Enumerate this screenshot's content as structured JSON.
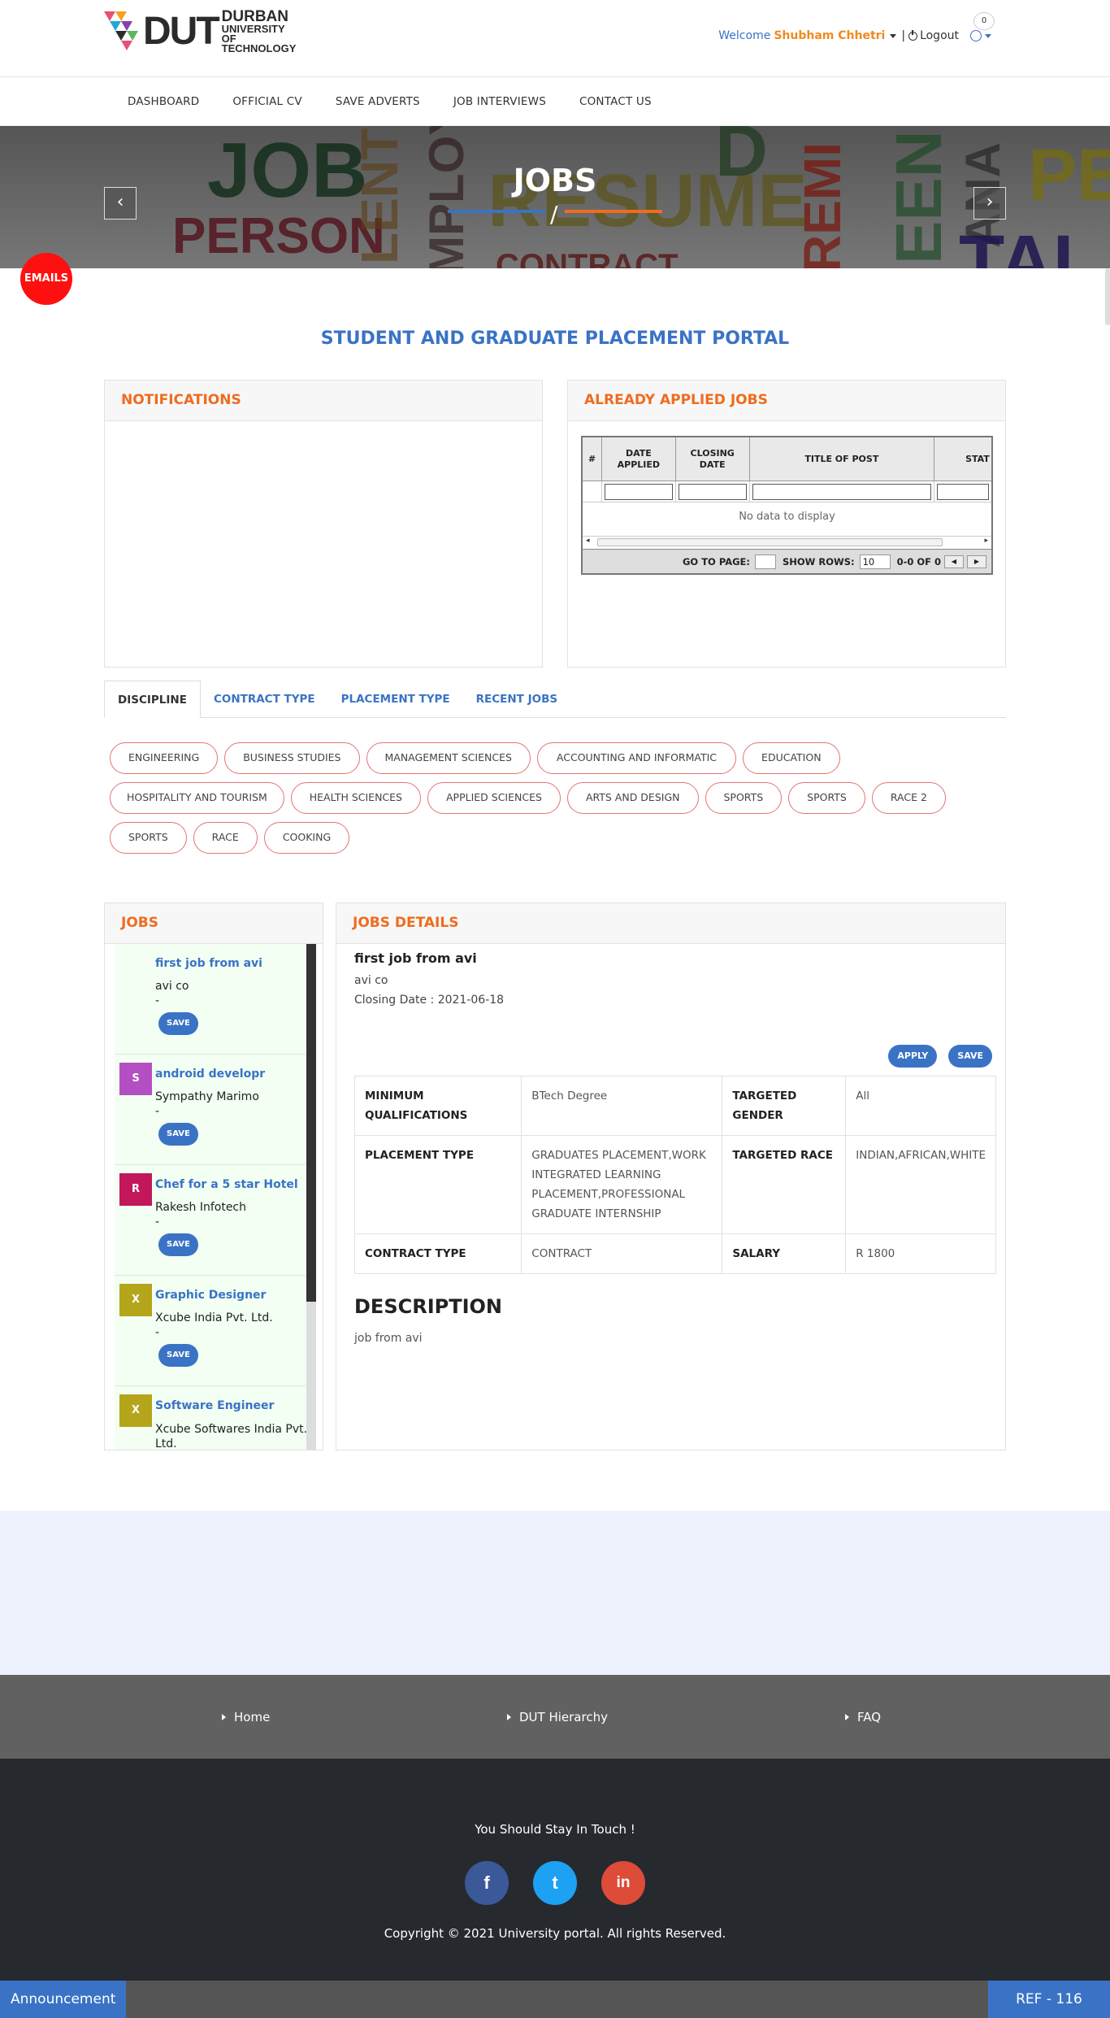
{
  "header": {
    "logo_big": "DUT",
    "logo_line1": "DURBAN",
    "logo_line2": "UNIVERSITY OF",
    "logo_line3": "TECHNOLOGY",
    "welcome": "Welcome",
    "username": "Shubham Chhetri",
    "logout": "Logout",
    "notif_count": "0"
  },
  "nav": [
    "DASHBOARD",
    "OFFICIAL CV",
    "SAVE ADVERTS",
    "JOB INTERVIEWS",
    "CONTACT US"
  ],
  "hero": {
    "title": "JOBS",
    "slash": "/",
    "prev": "‹",
    "next": "›",
    "bg_words": [
      "JOB",
      "PERSON",
      "LENT",
      "MPLOYE",
      "RESUME",
      "CONTRACT",
      "D",
      "REMI",
      "EEN",
      "ANA",
      "PE",
      "TAL"
    ]
  },
  "emails_label": "EMAILS",
  "portal_title": "STUDENT AND GRADUATE PLACEMENT PORTAL",
  "notifications": {
    "title": "NOTIFICATIONS"
  },
  "applied": {
    "title": "ALREADY APPLIED JOBS",
    "columns": [
      "#",
      "DATE APPLIED",
      "CLOSING DATE",
      "TITLE OF POST",
      "STAT"
    ],
    "empty": "No data to display",
    "pager": {
      "goto": "GO TO PAGE:",
      "rows": "SHOW ROWS:",
      "rows_value": "10",
      "range": "0-0 OF 0"
    }
  },
  "tabs": [
    "DISCIPLINE",
    "CONTRACT TYPE",
    "PLACEMENT TYPE",
    "RECENT JOBS"
  ],
  "disciplines": [
    "ENGINEERING",
    "BUSINESS STUDIES",
    "MANAGEMENT SCIENCES",
    "ACCOUNTING AND INFORMATIC",
    "EDUCATION",
    "HOSPITALITY AND TOURISM",
    "HEALTH SCIENCES",
    "APPLIED SCIENCES",
    "ARTS AND DESIGN",
    "SPORTS",
    "SPORTS",
    "RACE 2",
    "SPORTS",
    "RACE",
    "COOKING"
  ],
  "jobs": {
    "title": "JOBS",
    "save_label": "SAVE",
    "items": [
      {
        "avatar": "",
        "color": "#f2fff2",
        "title": "first job from avi",
        "company": "avi co",
        "dash": "-"
      },
      {
        "avatar": "S",
        "color": "#b44fc3",
        "title": "android developr",
        "company": "Sympathy Marimo",
        "dash": "-"
      },
      {
        "avatar": "R",
        "color": "#c2185b",
        "title": "Chef for a 5 star Hotel",
        "company": "Rakesh Infotech",
        "dash": "-"
      },
      {
        "avatar": "X",
        "color": "#b5a51a",
        "title": "Graphic Designer",
        "company": "Xcube India Pvt. Ltd.",
        "dash": "-"
      },
      {
        "avatar": "X",
        "color": "#b5a51a",
        "title": "Software Engineer",
        "company": "Xcube Softwares India Pvt. Ltd.",
        "dash": ""
      }
    ]
  },
  "details": {
    "title": "JOBS DETAILS",
    "job_title": "first job from avi",
    "company": "avi co",
    "closing": "Closing Date : 2021-06-18",
    "apply": "APPLY",
    "save": "SAVE",
    "rows": [
      {
        "k1": "MINIMUM QUALIFICATIONS",
        "v1": "BTech Degree",
        "k2": "TARGETED GENDER",
        "v2": "All"
      },
      {
        "k1": "PLACEMENT TYPE",
        "v1": "GRADUATES PLACEMENT,WORK INTEGRATED LEARNING PLACEMENT,PROFESSIONAL GRADUATE INTERNSHIP",
        "k2": "TARGETED RACE",
        "v2": "INDIAN,AFRICAN,WHITE"
      },
      {
        "k1": "CONTRACT TYPE",
        "v1": "CONTRACT",
        "k2": "SALARY",
        "v2": "R 1800"
      }
    ],
    "desc_title": "DESCRIPTION",
    "desc": "job from avi"
  },
  "footer": {
    "links": [
      "Home",
      "DUT Hierarchy",
      "FAQ"
    ],
    "stay": "You Should Stay In Touch !",
    "social": [
      "f",
      "t",
      "in"
    ],
    "copyright": "Copyright © 2021 University portal. All rights Reserved.",
    "announcement": "Announcement",
    "ref": "REF - 116"
  },
  "colors": {
    "accent_blue": "#3a73c5",
    "accent_orange": "#ef6c1e",
    "emails_red": "#ff1010"
  }
}
